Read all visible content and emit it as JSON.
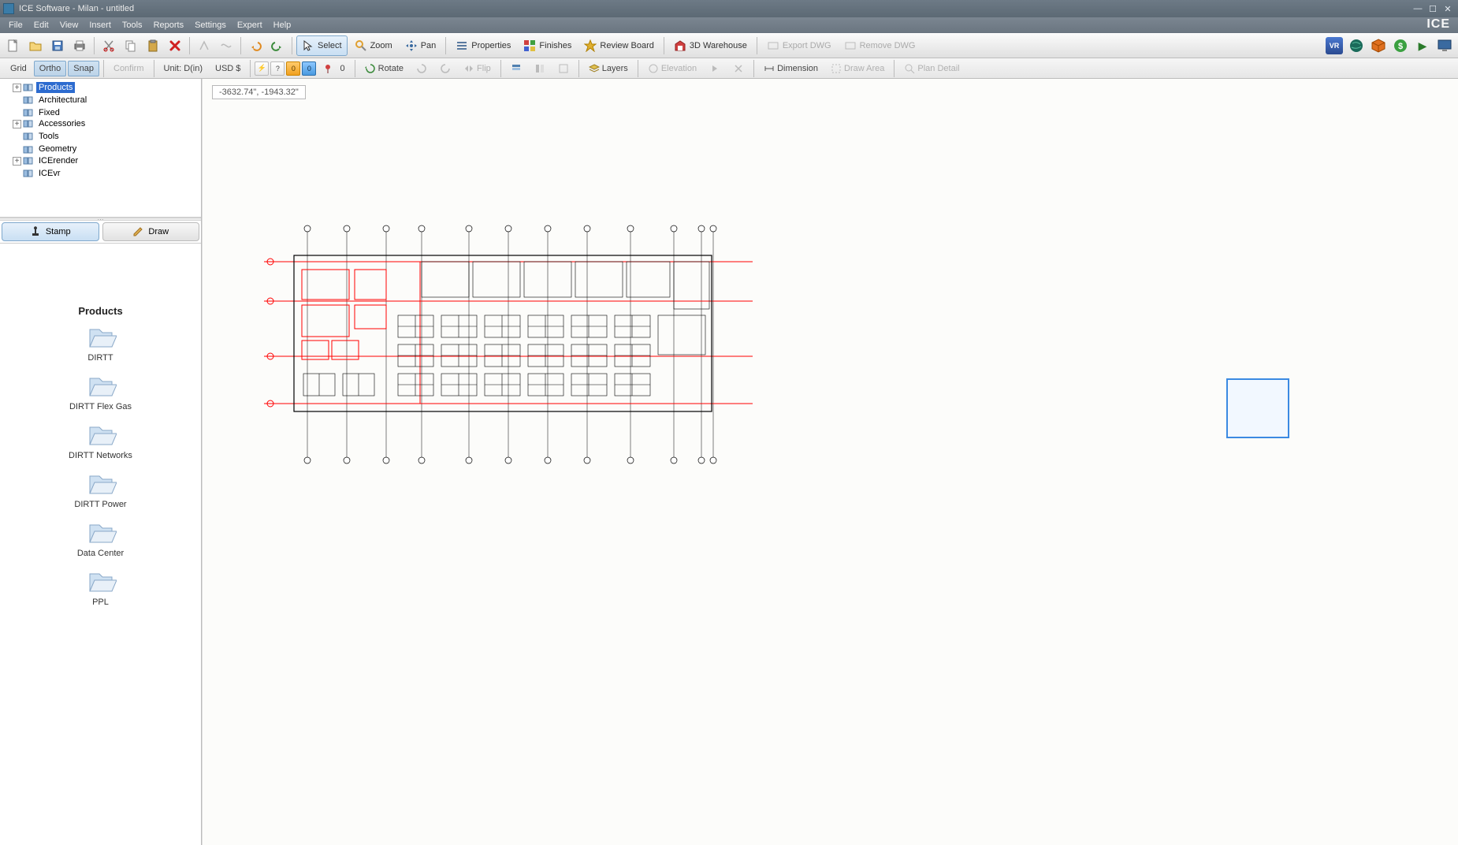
{
  "window": {
    "title": "ICE Software - Milan - untitled",
    "brand": "ICE"
  },
  "menu": [
    "File",
    "Edit",
    "View",
    "Insert",
    "Tools",
    "Reports",
    "Settings",
    "Expert",
    "Help"
  ],
  "toolbar1": {
    "select": "Select",
    "zoom": "Zoom",
    "pan": "Pan",
    "properties": "Properties",
    "finishes": "Finishes",
    "review": "Review Board",
    "warehouse": "3D Warehouse",
    "exportdwg": "Export DWG",
    "removedwg": "Remove DWG"
  },
  "toolbar2": {
    "grid": "Grid",
    "ortho": "Ortho",
    "snap": "Snap",
    "confirm": "Confirm",
    "unit": "Unit: D(in)",
    "currency": "USD $",
    "lockcount": "0",
    "flagcount": "0",
    "pincount": "0",
    "rotate": "Rotate",
    "flip": "Flip",
    "layers": "Layers",
    "elevation": "Elevation",
    "dimension": "Dimension",
    "drawarea": "Draw Area",
    "plandetail": "Plan Detail",
    "qmark": "?"
  },
  "tree": [
    {
      "label": "Products",
      "expandable": true,
      "selected": true
    },
    {
      "label": "Architectural",
      "expandable": false
    },
    {
      "label": "Fixed",
      "expandable": false
    },
    {
      "label": "Accessories",
      "expandable": true
    },
    {
      "label": "Tools",
      "expandable": false
    },
    {
      "label": "Geometry",
      "expandable": false
    },
    {
      "label": "ICErender",
      "expandable": true
    },
    {
      "label": "ICEvr",
      "expandable": false
    }
  ],
  "tabs": {
    "stamp": "Stamp",
    "draw": "Draw"
  },
  "products": {
    "heading": "Products",
    "items": [
      "DIRTT",
      "DIRTT Flex Gas",
      "DIRTT Networks",
      "DIRTT Power",
      "Data Center",
      "PPL"
    ]
  },
  "canvas": {
    "coords": "-3632.74\", -1943.32\""
  }
}
